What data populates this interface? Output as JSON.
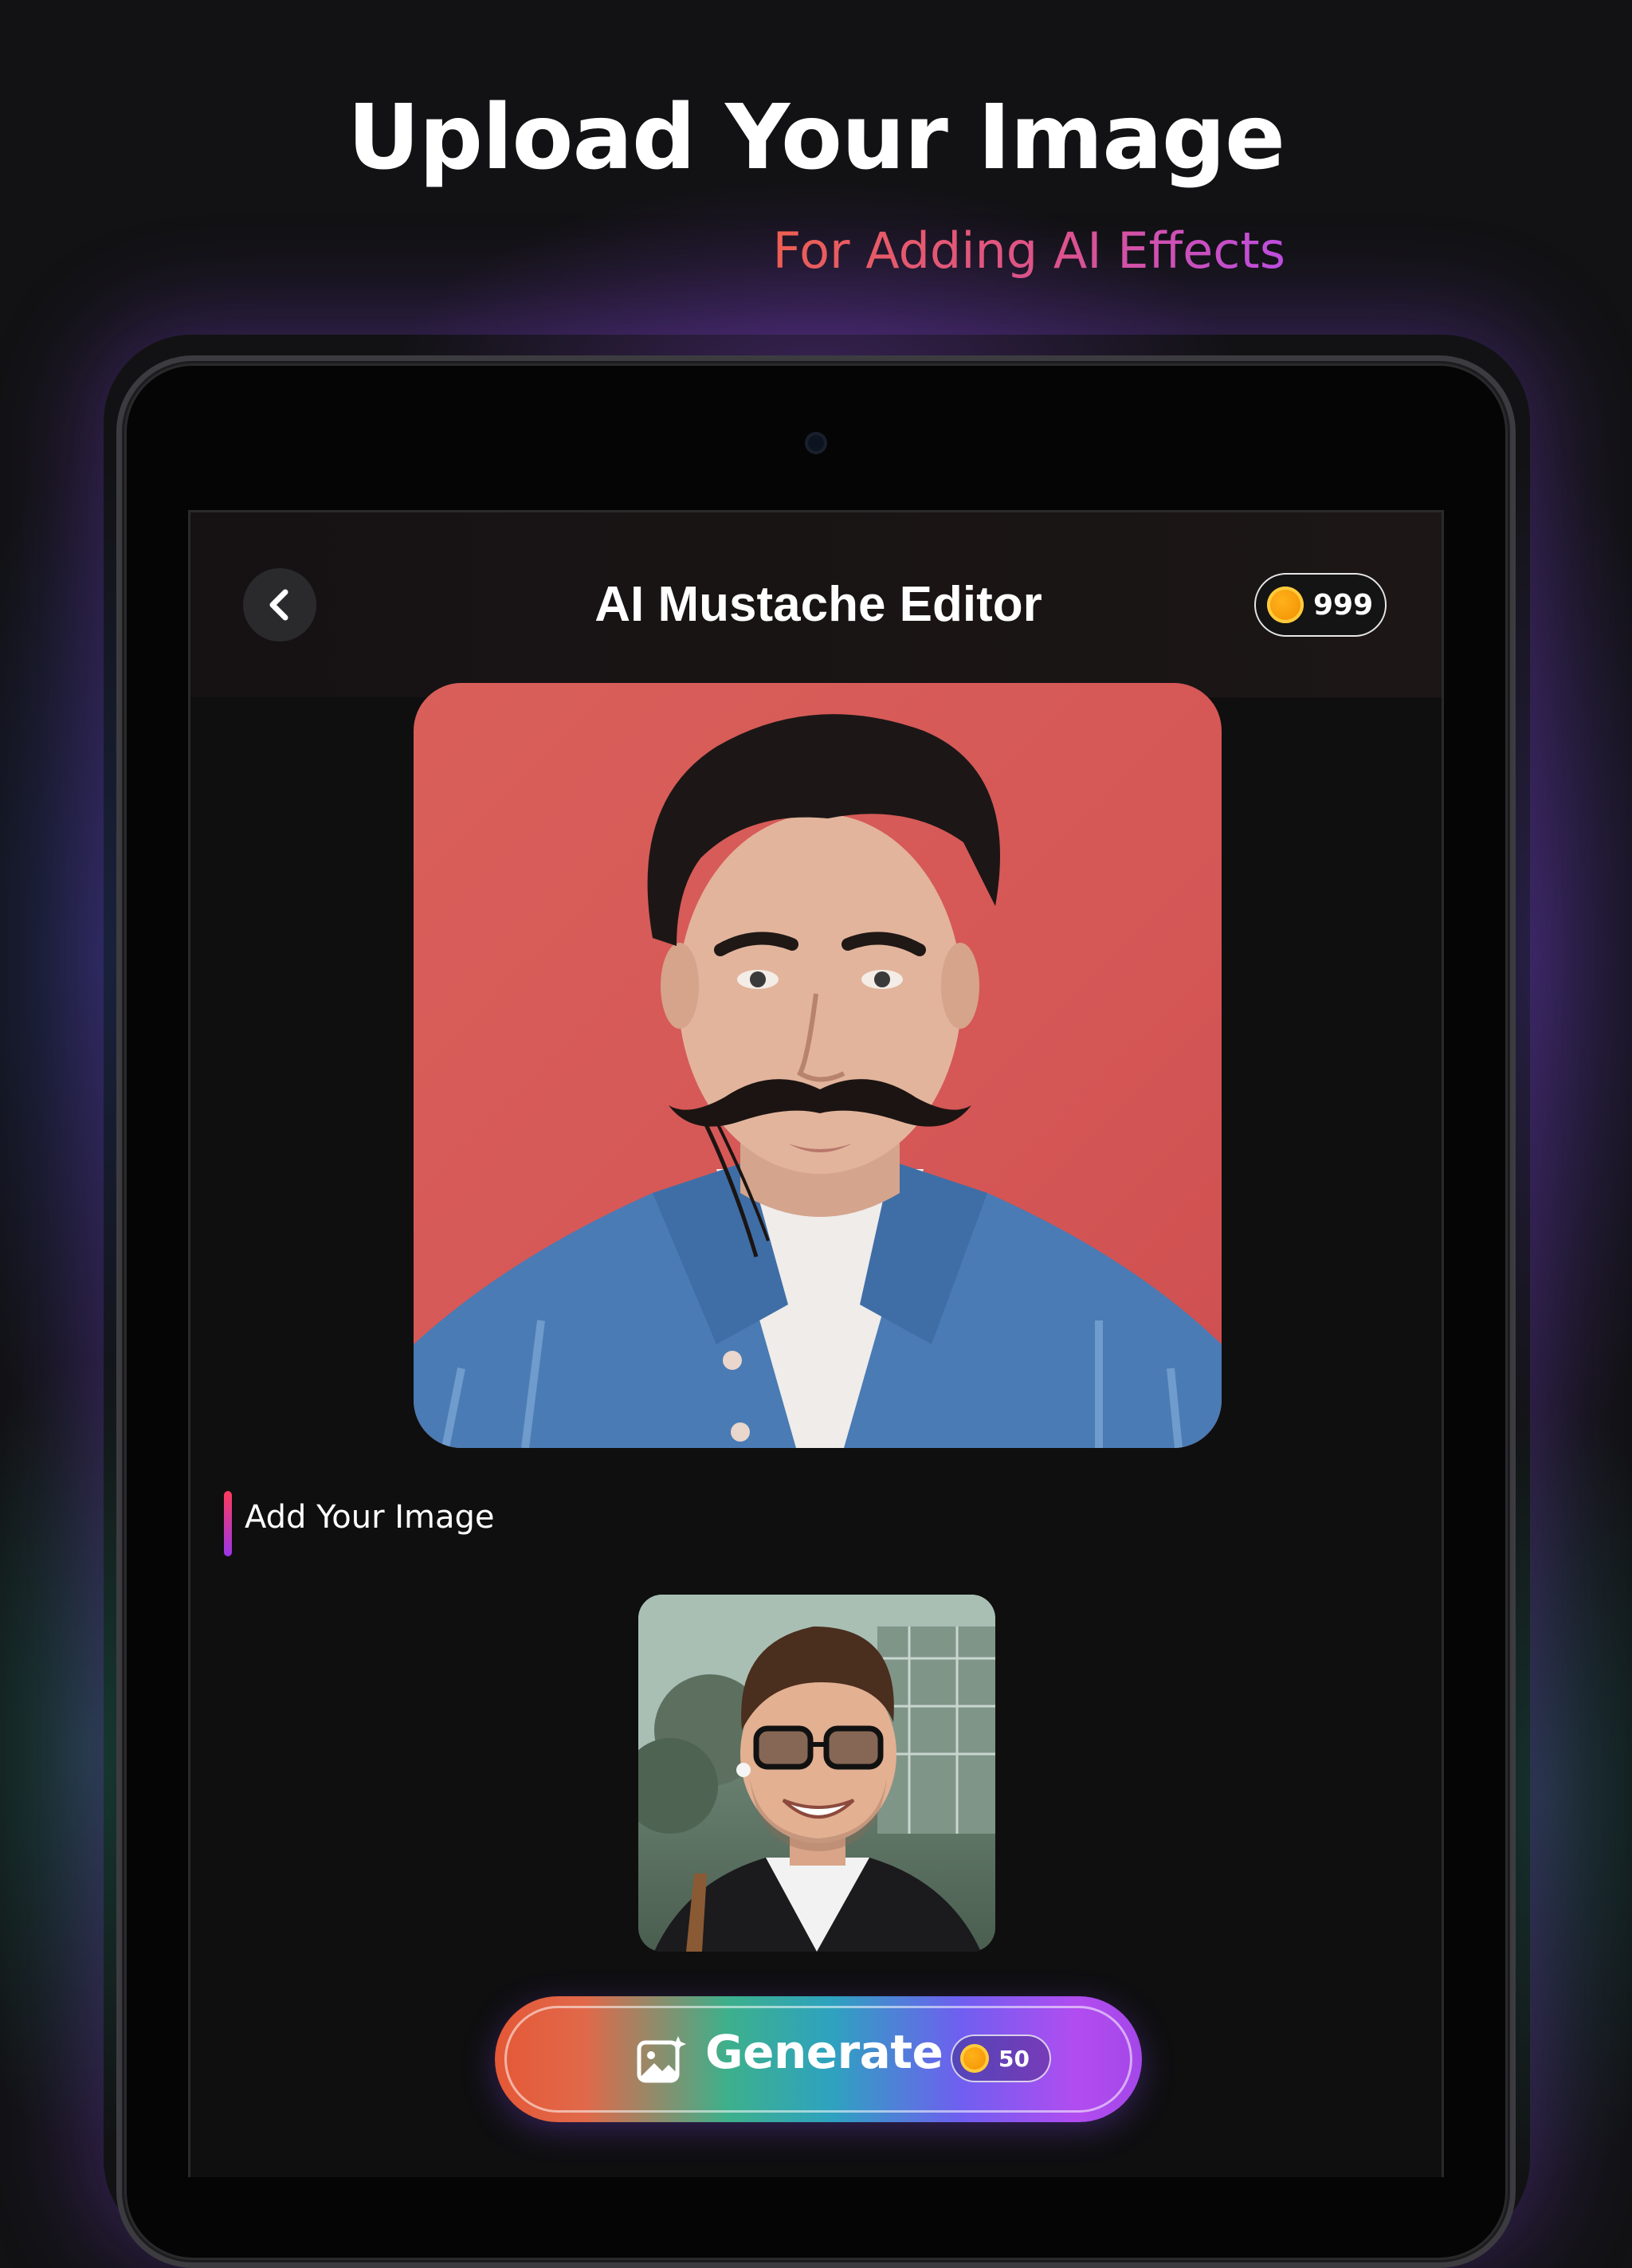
{
  "marketing": {
    "headline": "Upload Your Image",
    "subheadline": "For Adding AI Effects"
  },
  "app_bar": {
    "title": "AI Mustache Editor",
    "coin_balance": "999",
    "back_icon": "chevron-left-icon",
    "coin_icon": "coin-icon"
  },
  "editor": {
    "section_label": "Add Your Image"
  },
  "generate": {
    "label": "Generate",
    "cost": "50",
    "icon": "image-sparkle-icon"
  },
  "colors": {
    "background": "#121214",
    "accent_orange": "#e55836",
    "accent_purple": "#a447e8",
    "coin": "#f59e0b",
    "preview_background": "#d55756"
  }
}
